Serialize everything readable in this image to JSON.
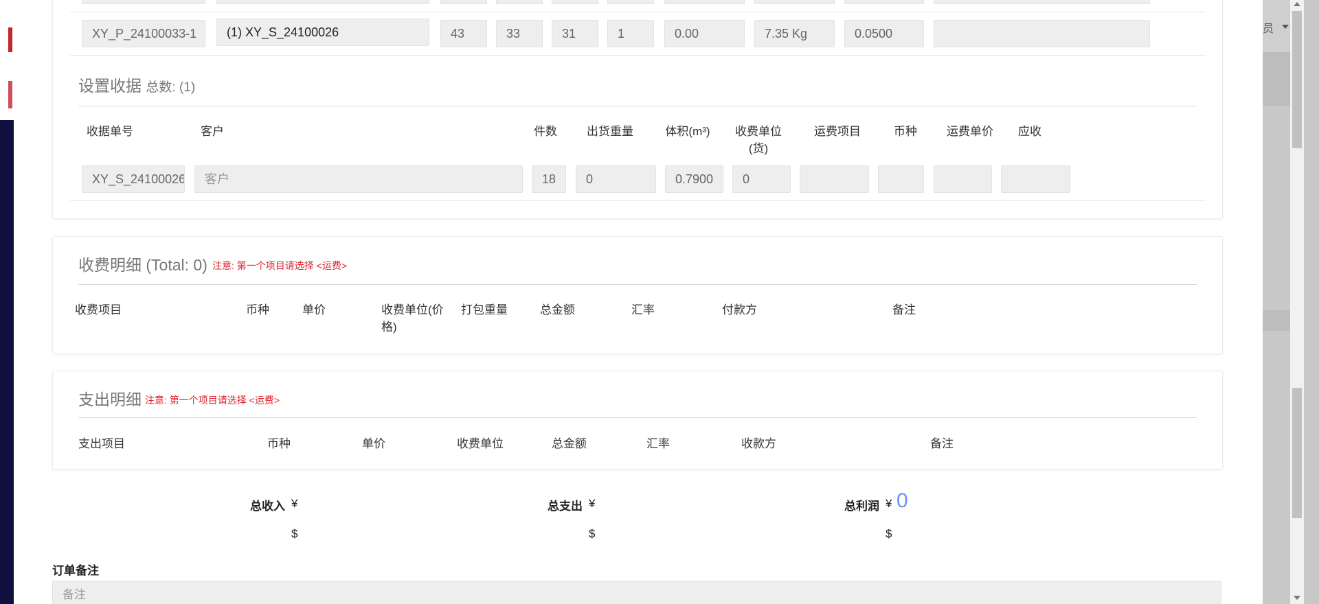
{
  "backdrop": {
    "user_label": "员"
  },
  "shipment_row": {
    "package_no": "XY_P_24100033-1",
    "receipt_ref": "(1) XY_S_24100026",
    "length": "43",
    "width": "33",
    "height": "31",
    "qty": "1",
    "value": "0.00",
    "weight": "7.35 Kg",
    "volume": "0.0500",
    "extra": ""
  },
  "receipt_section": {
    "title": "设置收据",
    "count_label": "总数: (1)",
    "headers": {
      "receipt_no": "收据单号",
      "customer": "客户",
      "pieces": "件数",
      "out_weight": "出货重量",
      "volume": "体积(m³)",
      "charge_unit": "收费单位(货)",
      "freight_item": "运费项目",
      "currency": "币种",
      "freight_unit_price": "运费单价",
      "receivable": "应收"
    },
    "row": {
      "receipt_no": "XY_S_24100026",
      "customer_placeholder": "客户",
      "pieces": "18",
      "out_weight": "0",
      "volume": "0.7900",
      "charge_unit": "0"
    }
  },
  "income_section": {
    "title": "收费明细 (Total: 0)",
    "warning": "注意:  第一个项目请选择 <运费>",
    "headers": {
      "item": "收费项目",
      "currency": "币种",
      "unit_price": "单价",
      "charge_unit": "收费单位(价格)",
      "pack_weight": "打包重量",
      "total_amount": "总金额",
      "rate": "汇率",
      "payer": "付款方",
      "remark": "备注"
    }
  },
  "expense_section": {
    "title": "支出明细",
    "warning": "注意:  第一个项目请选择 <运费>",
    "headers": {
      "item": "支出项目",
      "currency": "币种",
      "unit_price": "单价",
      "charge_unit": "收费单位",
      "total_amount": "总金额",
      "rate": "汇率",
      "payee": "收款方",
      "remark": "备注"
    }
  },
  "totals": {
    "income_label": "总收入",
    "expense_label": "总支出",
    "profit_label": "总利润",
    "yen": "¥",
    "dollar": "$",
    "profit_value": "0"
  },
  "notes": {
    "label": "订单备注",
    "placeholder": "备注"
  }
}
